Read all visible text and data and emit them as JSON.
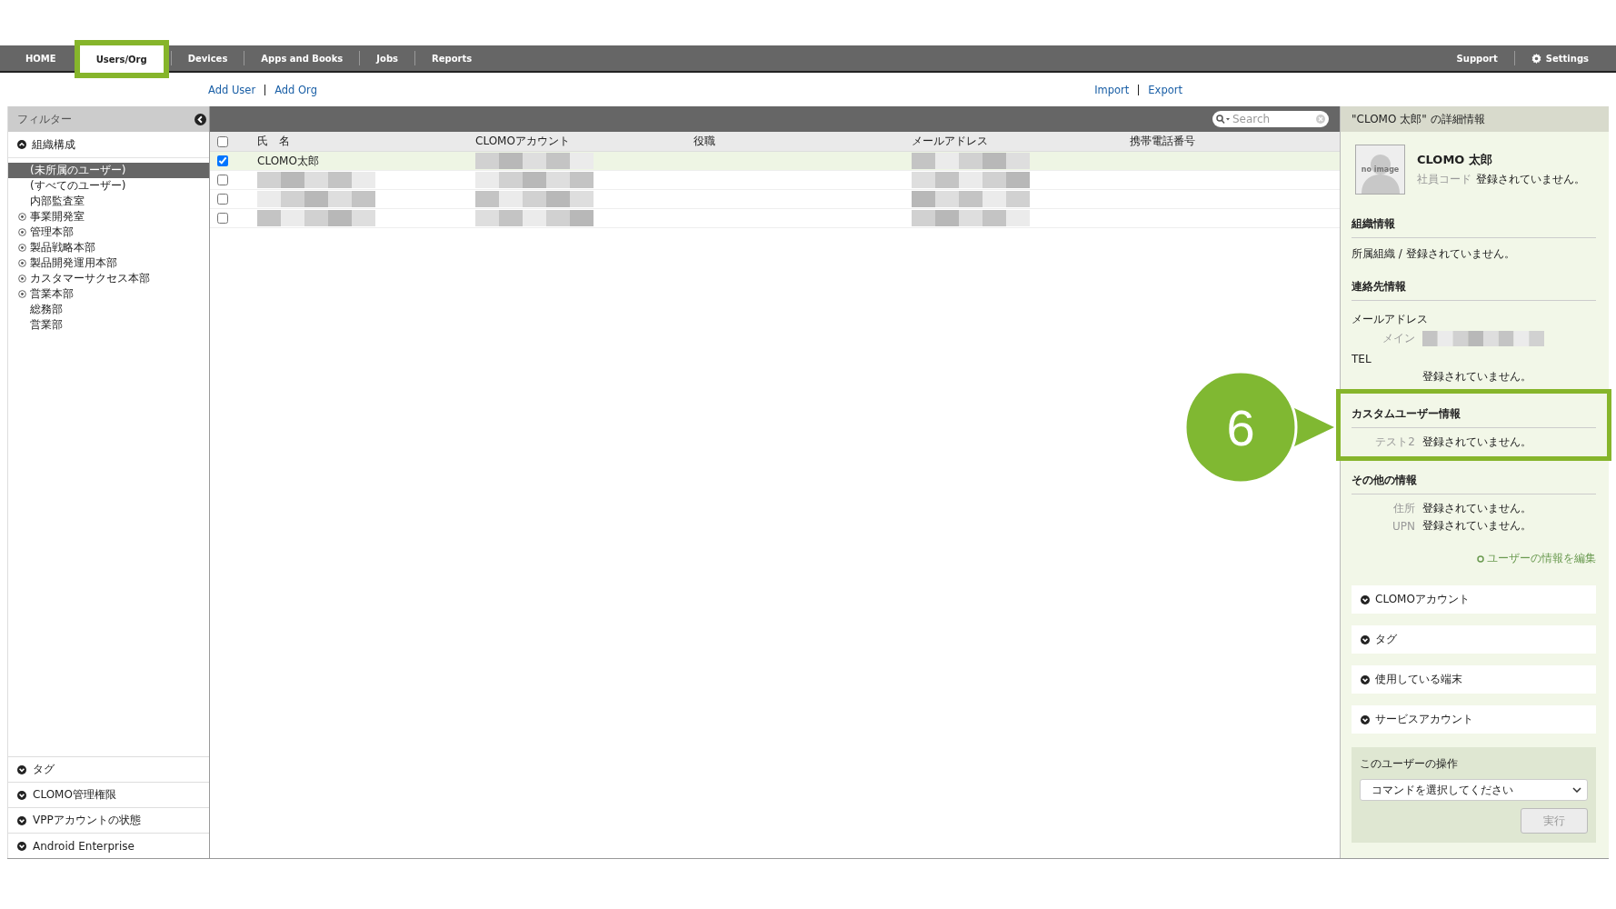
{
  "nav": {
    "tabs": [
      {
        "label": "HOME",
        "selected": false
      },
      {
        "label": "Users/Org",
        "selected": true
      },
      {
        "label": "Devices",
        "selected": false
      },
      {
        "label": "Apps and Books",
        "selected": false
      },
      {
        "label": "Jobs",
        "selected": false
      },
      {
        "label": "Reports",
        "selected": false
      }
    ],
    "right": [
      {
        "label": "Support",
        "kind": "text"
      },
      {
        "label": "Settings",
        "kind": "gear"
      }
    ]
  },
  "actions_left": [
    "Add User",
    "Add Org"
  ],
  "actions_right": [
    "Import",
    "Export"
  ],
  "filter": {
    "title": "フィルター",
    "tree": {
      "label": "組織構成",
      "expanded": true,
      "children": [
        {
          "label": "(未所属のユーザー)",
          "kind": "leaf",
          "selected": true
        },
        {
          "label": "(すべてのユーザー)",
          "kind": "leaf",
          "selected": false
        },
        {
          "label": "内部監査室",
          "kind": "leaf",
          "selected": false
        },
        {
          "label": "事業開発室",
          "kind": "branch",
          "selected": false
        },
        {
          "label": "管理本部",
          "kind": "branch",
          "selected": false
        },
        {
          "label": "製品戦略本部",
          "kind": "branch",
          "selected": false
        },
        {
          "label": "製品開発運用本部",
          "kind": "branch",
          "selected": false
        },
        {
          "label": "カスタマーサクセス本部",
          "kind": "branch",
          "selected": false
        },
        {
          "label": "営業本部",
          "kind": "branch",
          "selected": false
        },
        {
          "label": "総務部",
          "kind": "leaf",
          "selected": false
        },
        {
          "label": "営業部",
          "kind": "leaf",
          "selected": false
        }
      ]
    },
    "sections": [
      {
        "label": "タグ",
        "expanded": false
      },
      {
        "label": "CLOMO管理権限",
        "expanded": false
      },
      {
        "label": "VPPアカウントの状態",
        "expanded": false
      },
      {
        "label": "Android Enterprise",
        "expanded": false
      }
    ]
  },
  "table": {
    "search": {
      "placeholder": "Search"
    },
    "all_checked": false,
    "columns": [
      "氏　名",
      "CLOMOアカウント",
      "役職",
      "メールアドレス",
      "携帯電話番号"
    ],
    "rows": [
      {
        "selected": true,
        "cells": [
          {
            "kind": "text",
            "text": "CLOMO太郎"
          },
          {
            "kind": "redacted"
          },
          {
            "kind": "empty"
          },
          {
            "kind": "redacted"
          },
          {
            "kind": "empty"
          }
        ]
      },
      {
        "selected": false,
        "cells": [
          {
            "kind": "redacted"
          },
          {
            "kind": "redacted"
          },
          {
            "kind": "empty"
          },
          {
            "kind": "redacted"
          },
          {
            "kind": "empty"
          }
        ]
      },
      {
        "selected": false,
        "cells": [
          {
            "kind": "redacted"
          },
          {
            "kind": "redacted"
          },
          {
            "kind": "empty"
          },
          {
            "kind": "redacted"
          },
          {
            "kind": "empty"
          }
        ]
      },
      {
        "selected": false,
        "cells": [
          {
            "kind": "redacted"
          },
          {
            "kind": "redacted"
          },
          {
            "kind": "empty"
          },
          {
            "kind": "redacted"
          },
          {
            "kind": "empty"
          }
        ]
      }
    ]
  },
  "detail": {
    "title": "\"CLOMO 太郎\" の詳細情報",
    "avatar_text": "no image",
    "name": "CLOMO 太郎",
    "code_label": "社員コード",
    "code_value": "登録されていません。",
    "sections": [
      {
        "title": "組織情報",
        "highlighted": false,
        "rows": [
          {
            "kind": "plain",
            "text": "所属組織 / 登録されていません。"
          }
        ]
      },
      {
        "title": "連絡先情報",
        "highlighted": false,
        "rows": [
          {
            "kind": "subheading",
            "text": "メールアドレス"
          },
          {
            "kind": "redacted_field",
            "label": "メイン"
          },
          {
            "kind": "subheading",
            "text": "TEL"
          },
          {
            "kind": "field",
            "value": "登録されていません。"
          }
        ]
      },
      {
        "title": "カスタムユーザー情報",
        "highlighted": true,
        "rows": [
          {
            "kind": "field",
            "label": "テスト2",
            "value": "登録されていません。"
          }
        ]
      },
      {
        "title": "その他の情報",
        "highlighted": false,
        "rows": [
          {
            "kind": "field",
            "label": "住所",
            "value": "登録されていません。"
          },
          {
            "kind": "field",
            "label": "UPN",
            "value": "登録されていません。"
          }
        ]
      }
    ],
    "edit_link": "ユーザーの情報を編集",
    "panels": [
      {
        "label": "CLOMOアカウント",
        "expanded": false
      },
      {
        "label": "タグ",
        "expanded": false
      },
      {
        "label": "使用している端末",
        "expanded": false
      },
      {
        "label": "サービスアカウント",
        "expanded": false
      }
    ],
    "operations": {
      "title": "このユーザーの操作",
      "select": "コマンドを選択してください",
      "button": "実行",
      "button_disabled": true
    }
  },
  "callout": {
    "label": "6"
  }
}
